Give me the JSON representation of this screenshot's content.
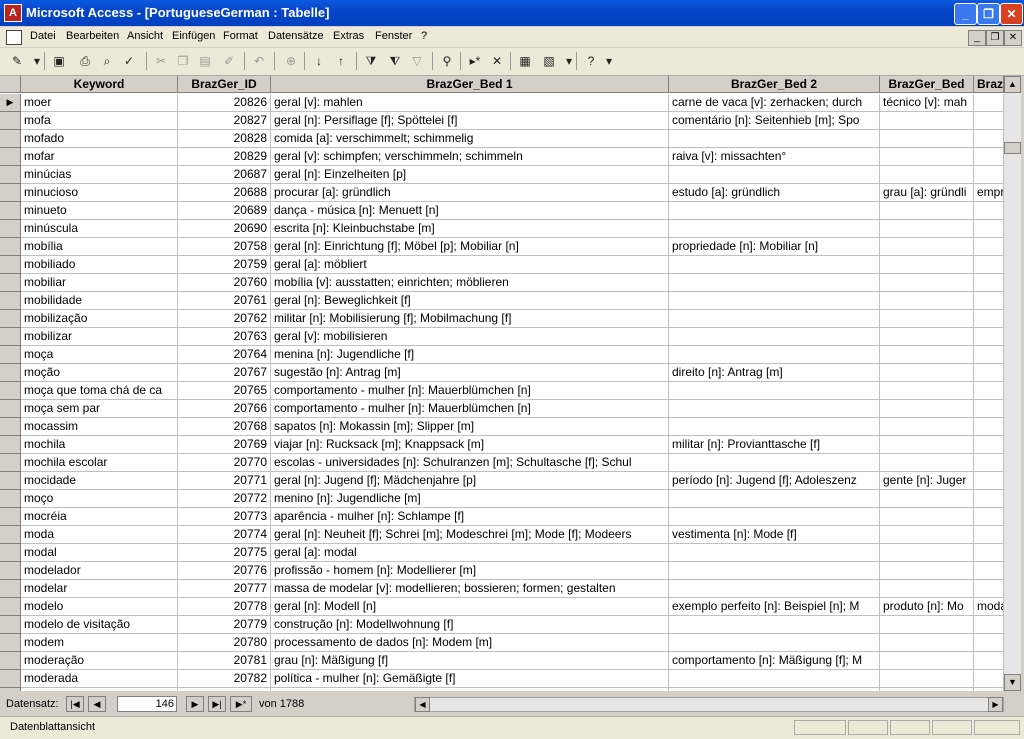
{
  "title": "Microsoft Access - [PortugueseGerman : Tabelle]",
  "menu": [
    "Datei",
    "Bearbeiten",
    "Ansicht",
    "Einfügen",
    "Format",
    "Datensätze",
    "Extras",
    "Fenster",
    "?"
  ],
  "columns": [
    "Keyword",
    "BrazGer_ID",
    "BrazGer_Bed 1",
    "BrazGer_Bed 2",
    "BrazGer_Bed",
    "Braz"
  ],
  "rows": [
    [
      "moer",
      "20826",
      "geral [v]: mahlen",
      "carne de vaca [v]: zerhacken; durch",
      "técnico [v]: mah",
      ""
    ],
    [
      "mofa",
      "20827",
      "geral [n]: Persiflage [f]; Spöttelei [f]",
      "comentário [n]: Seitenhieb [m]; Spo",
      "",
      ""
    ],
    [
      "mofado",
      "20828",
      "comida [a]: verschimmelt; schimmelig",
      "",
      "",
      ""
    ],
    [
      "mofar",
      "20829",
      "geral [v]: schimpfen; verschimmeln; schimmeln",
      "raiva [v]: missachten°",
      "",
      ""
    ],
    [
      "minúcias",
      "20687",
      "geral [n]: Einzelheiten [p]",
      "",
      "",
      ""
    ],
    [
      "minucioso",
      "20688",
      "procurar [a]: gründlich",
      "estudo [a]: gründlich",
      "grau [a]: gründli",
      "empr"
    ],
    [
      "minueto",
      "20689",
      "dança - música [n]: Menuett [n]",
      "",
      "",
      ""
    ],
    [
      "minúscula",
      "20690",
      "escrita [n]: Kleinbuchstabe [m]",
      "",
      "",
      ""
    ],
    [
      "mobília",
      "20758",
      "geral [n]: Einrichtung [f]; Möbel [p]; Mobiliar [n]",
      "propriedade [n]: Mobiliar [n]",
      "",
      ""
    ],
    [
      "mobiliado",
      "20759",
      "geral [a]: möbliert",
      "",
      "",
      ""
    ],
    [
      "mobiliar",
      "20760",
      "mobília [v]: ausstatten; einrichten; möblieren",
      "",
      "",
      ""
    ],
    [
      "mobilidade",
      "20761",
      "geral [n]: Beweglichkeit [f]",
      "",
      "",
      ""
    ],
    [
      "mobilização",
      "20762",
      "militar [n]: Mobilisierung [f]; Mobilmachung [f]",
      "",
      "",
      ""
    ],
    [
      "mobilizar",
      "20763",
      "geral [v]: mobilisieren",
      "",
      "",
      ""
    ],
    [
      "moça",
      "20764",
      "menina [n]: Jugendliche [f]",
      "",
      "",
      ""
    ],
    [
      "moção",
      "20767",
      "sugestão [n]: Antrag [m]",
      "direito [n]: Antrag [m]",
      "",
      ""
    ],
    [
      "moça que toma chá de ca",
      "20765",
      "comportamento - mulher [n]: Mauerblümchen [n]",
      "",
      "",
      ""
    ],
    [
      "moça sem par",
      "20766",
      "comportamento - mulher [n]: Mauerblümchen [n]",
      "",
      "",
      ""
    ],
    [
      "mocassim",
      "20768",
      "sapatos [n]: Mokassin [m]; Slipper [m]",
      "",
      "",
      ""
    ],
    [
      "mochila",
      "20769",
      "viajar [n]: Rucksack [m]; Knappsack [m]",
      "militar [n]: Provianttasche [f]",
      "",
      ""
    ],
    [
      "mochila escolar",
      "20770",
      "escolas - universidades [n]: Schulranzen [m]; Schultasche [f]; Schul",
      "",
      "",
      ""
    ],
    [
      "mocidade",
      "20771",
      "geral [n]: Jugend [f]; Mädchenjahre [p]",
      "período [n]: Jugend [f]; Adoleszenz",
      "gente [n]: Juger",
      ""
    ],
    [
      "moço",
      "20772",
      "menino [n]: Jugendliche [m]",
      "",
      "",
      ""
    ],
    [
      "mocréia",
      "20773",
      "aparência - mulher [n]: Schlampe [f]",
      "",
      "",
      ""
    ],
    [
      "moda",
      "20774",
      "geral [n]: Neuheit [f]; Schrei [m]; Modeschrei [m]; Mode [f]; Modeers",
      "vestimenta [n]: Mode [f]",
      "",
      ""
    ],
    [
      "modal",
      "20775",
      "geral [a]: modal",
      "",
      "",
      ""
    ],
    [
      "modelador",
      "20776",
      "profissão - homem [n]: Modellierer [m]",
      "",
      "",
      ""
    ],
    [
      "modelar",
      "20777",
      "massa de modelar [v]: modellieren; bossieren; formen; gestalten",
      "",
      "",
      ""
    ],
    [
      "modelo",
      "20778",
      "geral [n]: Modell [n]",
      "exemplo perfeito [n]: Beispiel [n]; M",
      "produto [n]: Mo",
      "moda"
    ],
    [
      "modelo de visitação",
      "20779",
      "construção [n]: Modellwohnung [f]",
      "",
      "",
      ""
    ],
    [
      "modem",
      "20780",
      "processamento de dados [n]: Modem [m]",
      "",
      "",
      ""
    ],
    [
      "moderação",
      "20781",
      "grau [n]: Mäßigung [f]",
      "comportamento [n]: Mäßigung [f]; M",
      "",
      ""
    ],
    [
      "moderada",
      "20782",
      "política - mulher [n]: Gemäßigte [f]",
      "",
      "",
      ""
    ],
    [
      "moderado",
      "20783",
      "geral [a]: mäßig",
      "",
      "",
      ""
    ]
  ],
  "nav": {
    "label": "Datensatz:",
    "current": "146",
    "of_text": "von 1788"
  },
  "status": "Datenblattansicht"
}
